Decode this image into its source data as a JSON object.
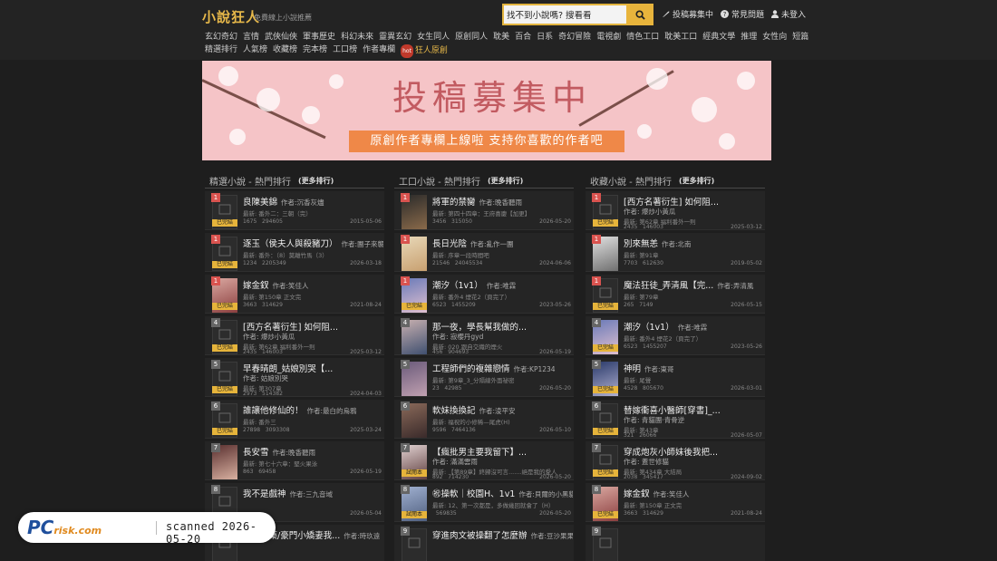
{
  "header": {
    "logo": "小說狂人",
    "tagline": "免費線上小說推薦",
    "search_value": "找不到小說嗎? 搜看看",
    "links": [
      {
        "icon": "feather-icon",
        "label": "投稿募集中"
      },
      {
        "icon": "question-icon",
        "label": "常見問題"
      },
      {
        "icon": "user-icon",
        "label": "未登入"
      }
    ]
  },
  "categories": {
    "row1": [
      "玄幻奇幻",
      "言情",
      "武俠仙俠",
      "軍事歷史",
      "科幻未來",
      "靈異玄幻",
      "女生同人",
      "原創同人",
      "耽美",
      "百合",
      "日系",
      "奇幻冒險",
      "電視劇",
      "情色工口",
      "耽美工口",
      "經典文學",
      "推理",
      "女性向",
      "短篇"
    ],
    "row2": [
      "精選排行",
      "人氣榜",
      "收藏榜",
      "完本榜",
      "工口榜",
      "作者專欄"
    ],
    "hot_badge": "hot",
    "hot_label": "狂人原創"
  },
  "banner": {
    "title": "投稿募集中",
    "subtitle": "原創作者專欄上線啦 支持你喜歡的作者吧"
  },
  "columns": [
    {
      "title": "精選小說 - 熱門排行",
      "more": "(更多排行)",
      "items": [
        {
          "rank": "1",
          "title": "良陳美錦",
          "author_label": "作者:",
          "author": "沉香灰燼",
          "latest": "最新: 番外二：三朝（完）",
          "count1": "1675",
          "count2": "294605",
          "date": "2015-05-06",
          "done": true,
          "cover": "blank",
          "rank_color": "#d9534f"
        },
        {
          "rank": "1",
          "title": "逐玉（侯夫人與殺豬刀）",
          "author_label": "作者:",
          "author": "團子來襲",
          "latest": "最新: 番外：（8）莫離竹馬（3）",
          "count1": "1234",
          "count2": "2205349",
          "date": "2026-03-18",
          "done": true,
          "cover": "blank",
          "rank_color": "#d9534f"
        },
        {
          "rank": "1",
          "title": "嫁金釵",
          "author_label": "作者:",
          "author": "笑佳人",
          "latest": "最新: 第150章 正文完",
          "count1": "3663",
          "count2": "314629",
          "date": "2021-08-24",
          "done": true,
          "cover": "img1",
          "rank_color": "#d9534f"
        },
        {
          "rank": "4",
          "title": "[西方名著衍生] 如何阻...",
          "author_label": "",
          "author": "",
          "latest2": "作者: 爆炒小黃瓜",
          "latest": "最新: 第62章 福利番外一則",
          "count1": "2435",
          "count2": "146003",
          "date": "2025-03-12",
          "done": true,
          "cover": "blank",
          "rank_color": "#666"
        },
        {
          "rank": "5",
          "title": "早春晴朗_姑娘別哭【...",
          "author_label": "",
          "author": "",
          "latest2": "作者: 姑娘別哭",
          "latest": "最新: 第307章",
          "count1": "2973",
          "count2": "514382",
          "date": "2024-04-03",
          "done": true,
          "cover": "blank",
          "rank_color": "#666"
        },
        {
          "rank": "6",
          "title": "誰讓他修仙的！",
          "author_label": "作者:",
          "author": "最白的烏鴉",
          "latest": "最新: 番外三",
          "count1": "27898",
          "count2": "3093308",
          "date": "2025-03-24",
          "done": true,
          "cover": "blank",
          "rank_color": "#666"
        },
        {
          "rank": "7",
          "title": "長安雪",
          "author_label": "作者:",
          "author": "晚香聽雨",
          "latest": "最新: 第七十六章：堅火果泳",
          "count1": "863",
          "count2": "69458",
          "date": "2026-05-19",
          "done": false,
          "cover": "img2",
          "rank_color": "#666"
        },
        {
          "rank": "8",
          "title": "我不是戲神",
          "author_label": "作者:",
          "author": "三九音域",
          "latest": "",
          "count1": "",
          "count2": "",
          "date": "2026-05-04",
          "done": false,
          "cover": "blank",
          "rank_color": "#666"
        },
        {
          "rank": "9",
          "title": "致命解藥/豪門小嬌妻我...",
          "author_label": "作者:",
          "author": "時玖遠",
          "latest": "",
          "count1": "",
          "count2": "",
          "date": "",
          "done": false,
          "cover": "blank",
          "rank_color": "#666"
        }
      ]
    },
    {
      "title": "工口小說 - 熱門排行",
      "more": "(更多排行)",
      "items": [
        {
          "rank": "1",
          "title": "將軍的禁臠",
          "author_label": "作者:",
          "author": "晚香聽雨",
          "latest": "最新: 第四十四章：王府喜慶【加更】",
          "count1": "3456",
          "count2": "315050",
          "date": "2026-05-20",
          "done": false,
          "cover": "img3",
          "rank_color": "#d9534f"
        },
        {
          "rank": "1",
          "title": "長日光陰",
          "author_label": "作者:",
          "author": "亂作一團",
          "latest": "最新: 序章一段時間吧",
          "count1": "21546",
          "count2": "24045534",
          "date": "2024-06-06",
          "done": false,
          "cover": "img4",
          "rank_color": "#d9534f"
        },
        {
          "rank": "1",
          "title": "潮汐（1v1）",
          "author_label": "作者:",
          "author": "唯霖",
          "latest": "最新: 番外4 煙花2（頁完了）",
          "count1": "6523",
          "count2": "1455209",
          "date": "2023-05-26",
          "done": true,
          "cover": "img5",
          "rank_color": "#d9534f"
        },
        {
          "rank": "4",
          "title": "那一夜，學長幫我做的...",
          "author_label": "",
          "author": "",
          "latest2": "作者: 寂櫻丹gyd",
          "latest": "最新: 020 跟自交織的煙火",
          "count1": "456",
          "count2": "904693",
          "date": "2026-05-19",
          "done": false,
          "cover": "img6",
          "rank_color": "#666"
        },
        {
          "rank": "5",
          "title": "工程師們的複雜戀情",
          "author_label": "作者:",
          "author": "KP1234",
          "latest": "最新: 第9章_3_分隔線外面祕密",
          "count1": "23",
          "count2": "42985",
          "date": "2026-05-20",
          "done": false,
          "cover": "img7",
          "rank_color": "#666"
        },
        {
          "rank": "6",
          "title": "軟妹換換記",
          "author_label": "作者:",
          "author": "淩平安",
          "latest": "最新: 福祝的小修稀—尾虎(H)",
          "count1": "9596",
          "count2": "7464136",
          "date": "2026-05-10",
          "done": false,
          "cover": "img8",
          "rank_color": "#666"
        },
        {
          "rank": "7",
          "title": "【瘋批男主要我留下】...",
          "author_label": "",
          "author": "",
          "latest2": "作者: 滿滿雲雨",
          "latest": "最新: 【第89章】終歸沒可言.......絕是我的愛人",
          "count1": "892",
          "count2": "714230",
          "date": "2026-05-20",
          "done": false,
          "trial": true,
          "cover": "img9",
          "rank_color": "#666"
        },
        {
          "rank": "8",
          "title": "㊗操軟｜校園H、1v1",
          "author_label": "作者:",
          "author": "貝爾的小黑貓",
          "latest": "最新: 12、第一次都是，多做幾回就會了（H）",
          "count1": "",
          "count2": "569835",
          "date": "2026-05-20",
          "done": false,
          "trial": true,
          "cover": "img10",
          "rank_color": "#666"
        },
        {
          "rank": "9",
          "title": "穿進肉文被操翻了怎麼辦",
          "author_label": "作者:",
          "author": "豆沙果果",
          "latest": "",
          "count1": "",
          "count2": "",
          "date": "",
          "done": false,
          "cover": "blank",
          "rank_color": "#666"
        }
      ]
    },
    {
      "title": "收藏小說 - 熱門排行",
      "more": "(更多排行)",
      "items": [
        {
          "rank": "1",
          "title": "[西方名著衍生] 如何阻...",
          "author_label": "",
          "author": "",
          "latest2": "作者: 爆炒小黃瓜",
          "latest": "最新: 第62章 福利番外一則",
          "count1": "2435",
          "count2": "146003",
          "date": "2025-03-12",
          "done": true,
          "cover": "blank",
          "rank_color": "#d9534f"
        },
        {
          "rank": "1",
          "title": "別來無恙",
          "author_label": "作者:",
          "author": "北南",
          "latest": "最新: 第91章",
          "count1": "7703",
          "count2": "612630",
          "date": "2019-05-02",
          "done": false,
          "cover": "img11",
          "rank_color": "#d9534f"
        },
        {
          "rank": "1",
          "title": "魔法狂徒_弄清風【完...",
          "author_label": "作者:",
          "author": "弄清風",
          "latest": "最新: 第79章",
          "count1": "265",
          "count2": "7149",
          "date": "2026-05-15",
          "done": true,
          "cover": "blank",
          "rank_color": "#d9534f"
        },
        {
          "rank": "4",
          "title": "潮汐（1v1）",
          "author_label": "作者:",
          "author": "唯霖",
          "latest": "最新: 番外4 煙花2（頁完了）",
          "count1": "6523",
          "count2": "1455207",
          "date": "2023-05-26",
          "done": true,
          "cover": "img5",
          "rank_color": "#666"
        },
        {
          "rank": "5",
          "title": "神明",
          "author_label": "作者:",
          "author": "東哥",
          "latest": "最新: 尾聲",
          "count1": "4528",
          "count2": "805670",
          "date": "2026-03-01",
          "done": true,
          "cover": "img12",
          "rank_color": "#666"
        },
        {
          "rank": "6",
          "title": "替嫁衝喜小醫師[穿書]_...",
          "author_label": "",
          "author": "",
          "latest2": "作者: 青貓團·青骨逆",
          "latest": "最新: 第43章",
          "count1": "321",
          "count2": "26066",
          "date": "2026-05-07",
          "done": true,
          "cover": "blank",
          "rank_color": "#666"
        },
        {
          "rank": "7",
          "title": "穿成炮灰小師妹後我把...",
          "author_label": "",
          "author": "",
          "latest2": "作者: 蓋世修貓",
          "latest": "最新: 第434章 大結局",
          "count1": "2038",
          "count2": "345417",
          "date": "2024-09-02",
          "done": true,
          "cover": "blank",
          "rank_color": "#666"
        },
        {
          "rank": "8",
          "title": "嫁金釵",
          "author_label": "作者:",
          "author": "笑佳人",
          "latest": "最新: 第150章 正文完",
          "count1": "3663",
          "count2": "314629",
          "date": "2021-08-24",
          "done": true,
          "cover": "img1",
          "rank_color": "#666"
        },
        {
          "rank": "9",
          "title": "",
          "author_label": "",
          "author": "",
          "latest": "",
          "count1": "",
          "count2": "",
          "date": "",
          "done": false,
          "cover": "blank",
          "rank_color": "#666"
        }
      ]
    }
  ],
  "labels": {
    "done": "已完結",
    "trial": "試閱本"
  },
  "watermark": {
    "logo": "PC",
    "logo_small": "risk.com",
    "text": "scanned 2026-05-20"
  },
  "colors": {
    "accent": "#e8b43c",
    "background": "#1e1e1e",
    "card": "#252525",
    "rank_top": "#d9534f"
  }
}
